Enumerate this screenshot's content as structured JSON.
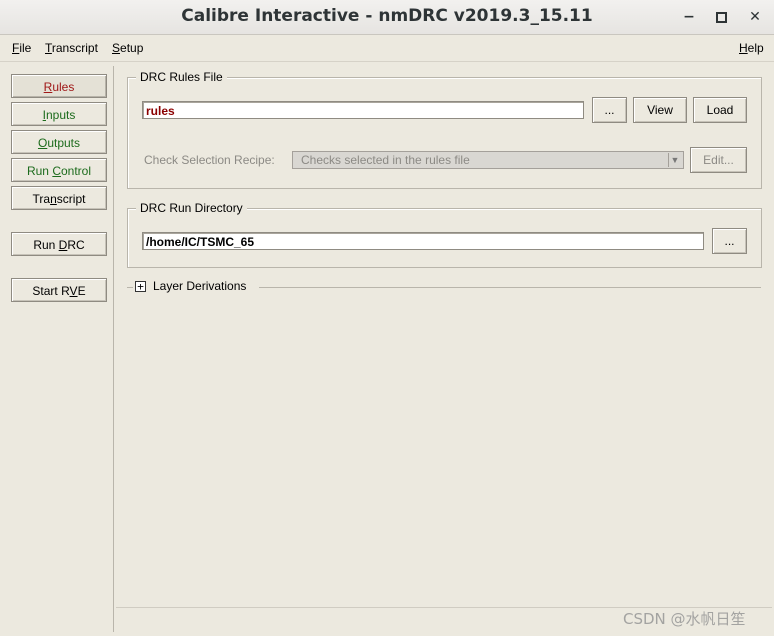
{
  "window": {
    "title": "Calibre Interactive - nmDRC v2019.3_15.11",
    "controls": {
      "minimize": "−",
      "maximize": "▫",
      "close": "✕"
    }
  },
  "menu": {
    "file": "File",
    "transcript": "Transcript",
    "setup": "Setup",
    "help": "Help"
  },
  "nav": {
    "rules": "Rules",
    "inputs": "Inputs",
    "outputs": "Outputs",
    "run_control": "Run Control",
    "transcript": "Transcript",
    "run_drc": "Run DRC",
    "start_rve": "Start RVE"
  },
  "rules_file": {
    "group_label": "DRC Rules File",
    "value": "rules",
    "browse_label": "...",
    "view_label": "View",
    "load_label": "Load",
    "check_recipe_label": "Check Selection Recipe:",
    "check_recipe_value": "Checks selected in the rules file",
    "edit_label": "Edit..."
  },
  "run_directory": {
    "group_label": "DRC Run Directory",
    "value": "/home/IC/TSMC_65",
    "browse_label": "..."
  },
  "layer_derivations": {
    "label": "Layer Derivations",
    "expander": "+"
  },
  "watermark": "CSDN @水帆日笙",
  "colors": {
    "background": "#ece9df",
    "nav_green": "#1c6b1c",
    "nav_red": "#a01818",
    "rules_value": "#8b0000"
  }
}
